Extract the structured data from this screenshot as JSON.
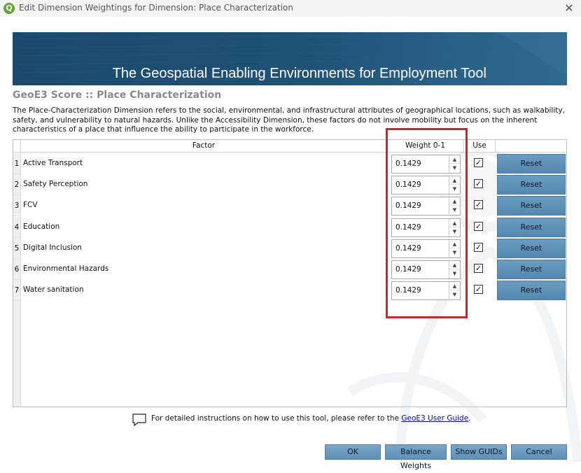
{
  "window": {
    "app_icon_letter": "Q",
    "title": "Edit Dimension Weightings for Dimension: Place Characterization",
    "close_glyph": "✕"
  },
  "banner": {
    "title": "The Geospatial Enabling Environments for Employment Tool"
  },
  "score_title": "GeoE3 Score :: Place Characterization",
  "description": "The Place-Characterization Dimension refers to the social, environmental, and infrastructural attributes of geographical locations, such as walkability, safety, and vulnerability to natural hazards. Unlike the Accessibility Dimension, these factors do not involve mobility but focus on the inherent characteristics of a place that influence the ability to participate in the workforce.",
  "table": {
    "headers": {
      "factor": "Factor",
      "weight": "Weight 0-1",
      "use": "Use",
      "reset": ""
    },
    "rows": [
      {
        "num": "1",
        "factor": "Active Transport",
        "weight": "0.1429",
        "use": true,
        "reset_label": "Reset"
      },
      {
        "num": "2",
        "factor": "Safety Perception",
        "weight": "0.1429",
        "use": true,
        "reset_label": "Reset"
      },
      {
        "num": "3",
        "factor": "FCV",
        "weight": "0.1429",
        "use": true,
        "reset_label": "Reset"
      },
      {
        "num": "4",
        "factor": "Education",
        "weight": "0.1429",
        "use": true,
        "reset_label": "Reset"
      },
      {
        "num": "5",
        "factor": "Digital Inclusion",
        "weight": "0.1429",
        "use": true,
        "reset_label": "Reset"
      },
      {
        "num": "6",
        "factor": "Environmental Hazards",
        "weight": "0.1429",
        "use": true,
        "reset_label": "Reset"
      },
      {
        "num": "7",
        "factor": "Water sanitation",
        "weight": "0.1429",
        "use": true,
        "reset_label": "Reset"
      }
    ]
  },
  "info": {
    "text": "For detailed instructions on how to use this tool, please refer to the ",
    "link": "GeoE3 User Guide",
    "suffix": "."
  },
  "buttons": {
    "ok": "OK",
    "balance": "Balance Weights",
    "show_guids": "Show GUIDs",
    "cancel": "Cancel"
  },
  "colors": {
    "highlight": "#d2232a",
    "button": "#6b9cc0",
    "banner": "#1f5076"
  }
}
